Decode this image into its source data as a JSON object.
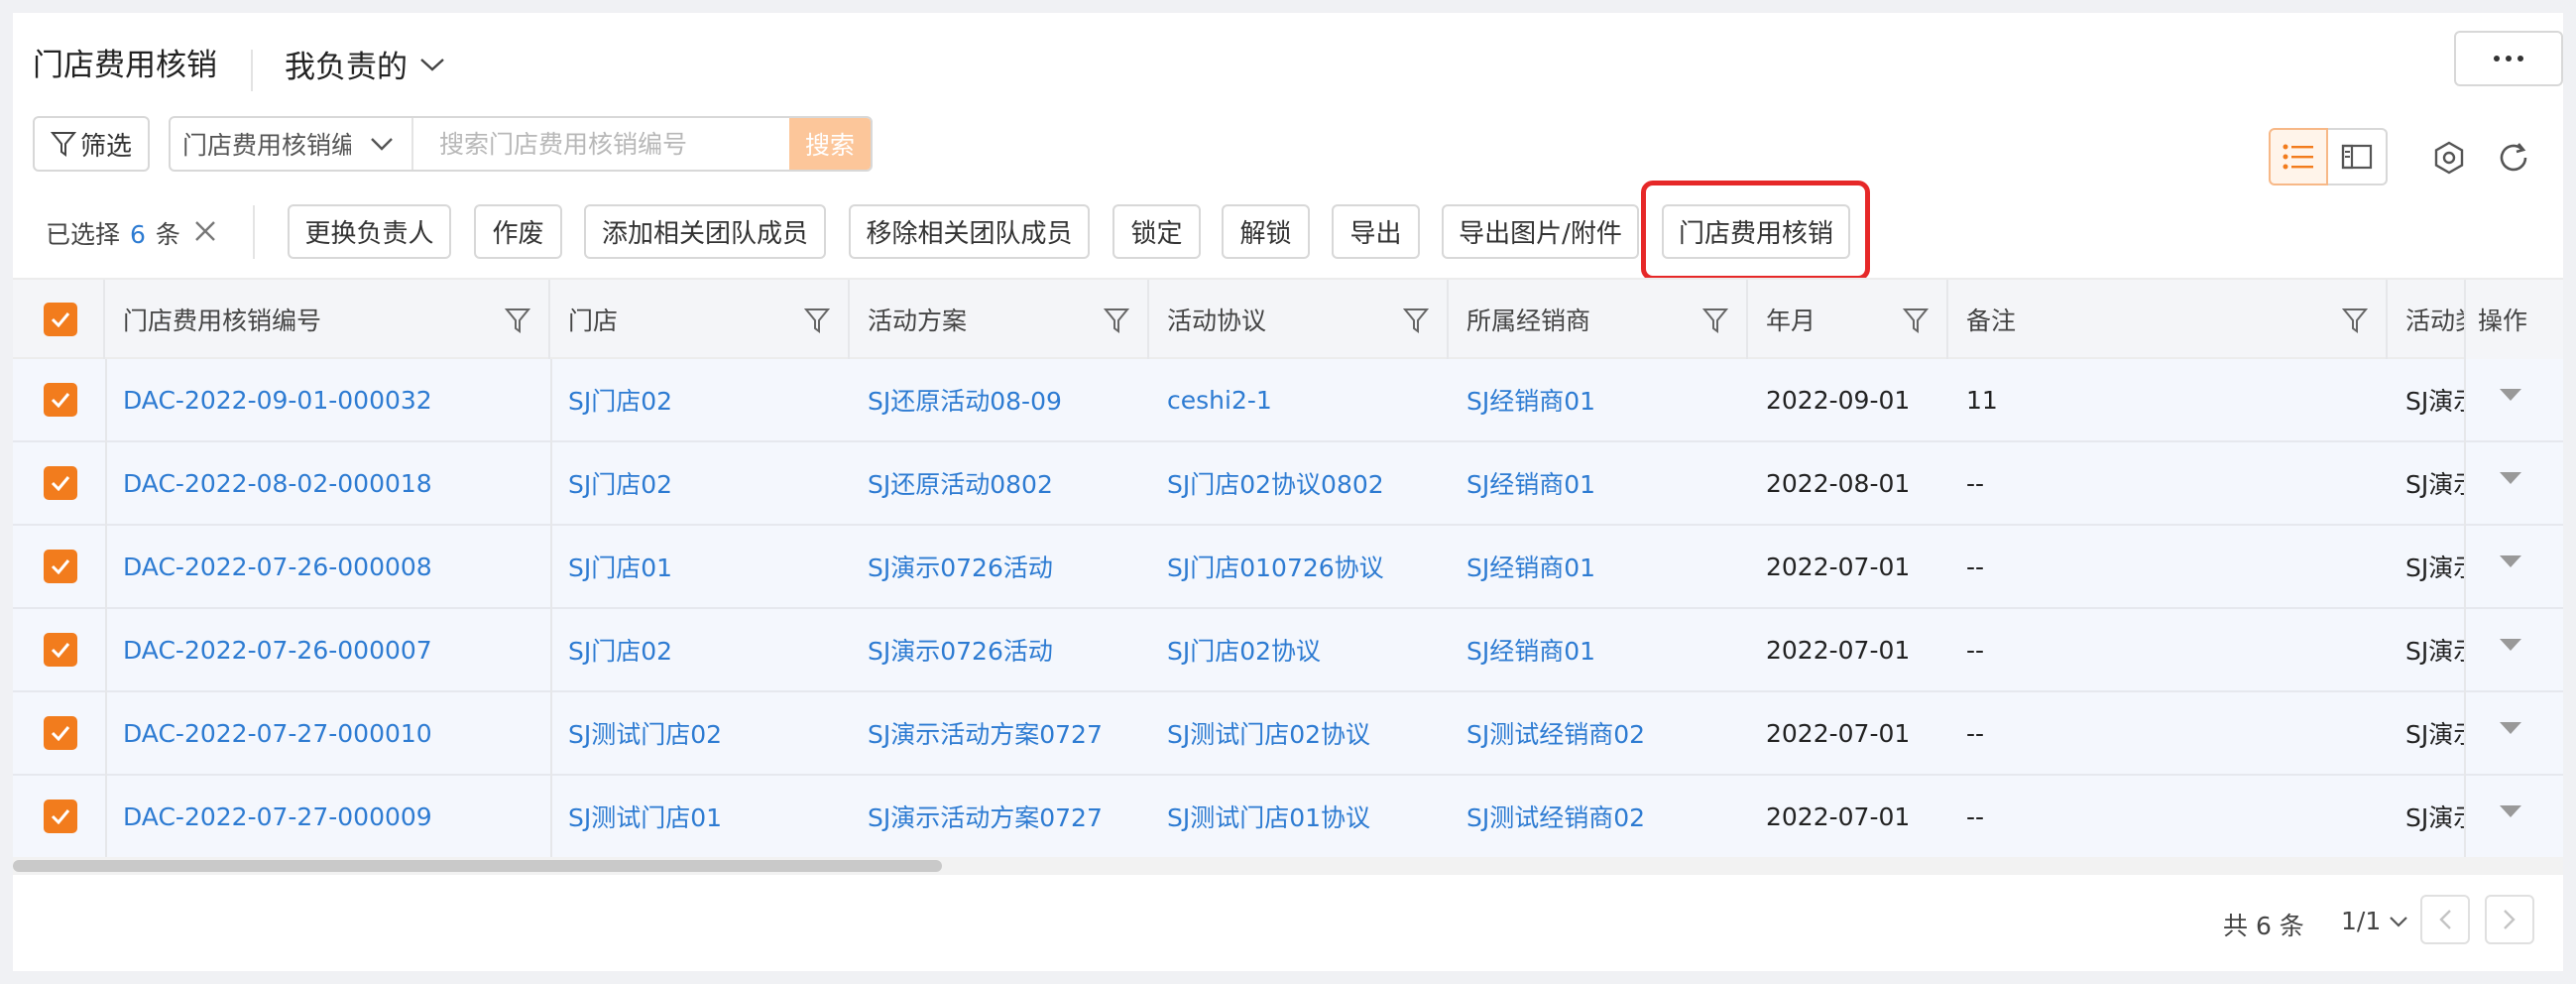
{
  "header": {
    "title": "门店费用核销",
    "view_selector": "我负责的"
  },
  "toolbar": {
    "filter_label": "筛选",
    "search_field": "门店费用核销编",
    "search_placeholder": "搜索门店费用核销编号",
    "search_button": "搜索"
  },
  "selection": {
    "prefix": "已选择",
    "count": "6",
    "suffix": "条"
  },
  "actions": [
    {
      "label": "更换负责人"
    },
    {
      "label": "作废"
    },
    {
      "label": "添加相关团队成员"
    },
    {
      "label": "移除相关团队成员"
    },
    {
      "label": "锁定"
    },
    {
      "label": "解锁"
    },
    {
      "label": "导出"
    },
    {
      "label": "导出图片/附件"
    },
    {
      "label": "门店费用核销"
    }
  ],
  "table": {
    "columns": [
      "门店费用核销编号",
      "门店",
      "活动方案",
      "活动协议",
      "所属经销商",
      "年月",
      "备注",
      "活动类",
      "操作"
    ],
    "rows": [
      {
        "code": "DAC-2022-09-01-000032",
        "store": "SJ门店02",
        "plan": "SJ还原活动08-09",
        "agreement": "ceshi2-1",
        "dealer": "SJ经销商01",
        "month": "2022-09-01",
        "remark": "11",
        "type": "SJ演示"
      },
      {
        "code": "DAC-2022-08-02-000018",
        "store": "SJ门店02",
        "plan": "SJ还原活动0802",
        "agreement": "SJ门店02协议0802",
        "dealer": "SJ经销商01",
        "month": "2022-08-01",
        "remark": "--",
        "type": "SJ演示"
      },
      {
        "code": "DAC-2022-07-26-000008",
        "store": "SJ门店01",
        "plan": "SJ演示0726活动",
        "agreement": "SJ门店010726协议",
        "dealer": "SJ经销商01",
        "month": "2022-07-01",
        "remark": "--",
        "type": "SJ演示"
      },
      {
        "code": "DAC-2022-07-26-000007",
        "store": "SJ门店02",
        "plan": "SJ演示0726活动",
        "agreement": "SJ门店02协议",
        "dealer": "SJ经销商01",
        "month": "2022-07-01",
        "remark": "--",
        "type": "SJ演示"
      },
      {
        "code": "DAC-2022-07-27-000010",
        "store": "SJ测试门店02",
        "plan": "SJ演示活动方案0727",
        "agreement": "SJ测试门店02协议",
        "dealer": "SJ测试经销商02",
        "month": "2022-07-01",
        "remark": "--",
        "type": "SJ演示"
      },
      {
        "code": "DAC-2022-07-27-000009",
        "store": "SJ测试门店01",
        "plan": "SJ演示活动方案0727",
        "agreement": "SJ测试门店01协议",
        "dealer": "SJ测试经销商02",
        "month": "2022-07-01",
        "remark": "--",
        "type": "SJ演示"
      }
    ]
  },
  "pagination": {
    "total": "共 6 条",
    "page": "1/1"
  },
  "colors": {
    "accent": "#f27c1d",
    "link": "#2d7bd2",
    "highlight": "#e62828"
  }
}
